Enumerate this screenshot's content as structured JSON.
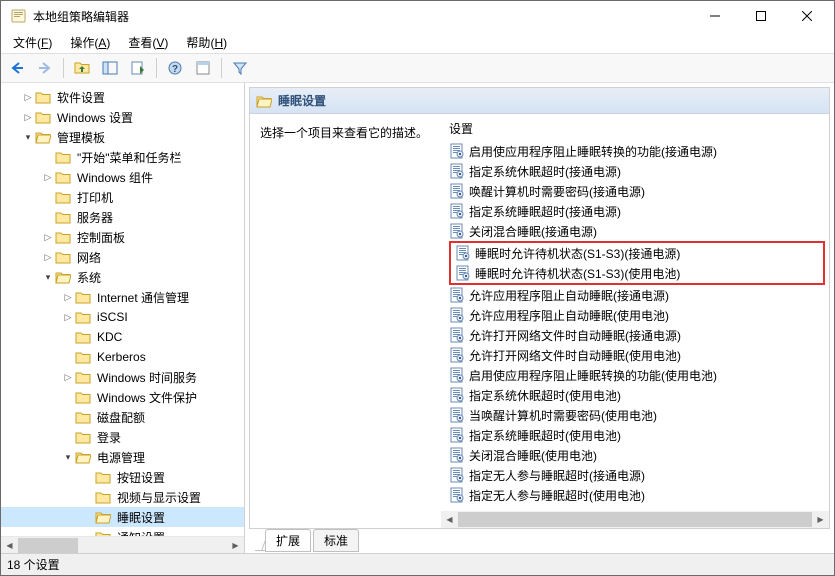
{
  "window": {
    "title": "本地组策略编辑器"
  },
  "menu": {
    "file": {
      "label": "文件",
      "accel": "F"
    },
    "action": {
      "label": "操作",
      "accel": "A"
    },
    "view": {
      "label": "查看",
      "accel": "V"
    },
    "help": {
      "label": "帮助",
      "accel": "H"
    }
  },
  "tree": {
    "软件设置": "软件设置",
    "Windows设置": "Windows 设置",
    "管理模板": "管理模板",
    "开始菜单和任务栏": "\"开始\"菜单和任务栏",
    "Windows组件": "Windows 组件",
    "打印机": "打印机",
    "服务器": "服务器",
    "控制面板": "控制面板",
    "网络": "网络",
    "系统": "系统",
    "Internet通信管理": "Internet 通信管理",
    "iSCSI": "iSCSI",
    "KDC": "KDC",
    "Kerberos": "Kerberos",
    "Windows时间服务": "Windows 时间服务",
    "Windows文件保护": "Windows 文件保护",
    "磁盘配额": "磁盘配额",
    "登录": "登录",
    "电源管理": "电源管理",
    "按钮设置": "按钮设置",
    "视频与显示设置": "视频与显示设置",
    "睡眠设置": "睡眠设置",
    "通知设置": "通知设置"
  },
  "rightHeader": "睡眠设置",
  "desc": "选择一个项目来查看它的描述。",
  "listHeader": "设置",
  "settings": [
    "启用使应用程序阻止睡眠转换的功能(接通电源)",
    "指定系统休眠超时(接通电源)",
    "唤醒计算机时需要密码(接通电源)",
    "指定系统睡眠超时(接通电源)",
    "关闭混合睡眠(接通电源)",
    "睡眠时允许待机状态(S1-S3)(接通电源)",
    "睡眠时允许待机状态(S1-S3)(使用电池)",
    "允许应用程序阻止自动睡眠(接通电源)",
    "允许应用程序阻止自动睡眠(使用电池)",
    "允许打开网络文件时自动睡眠(接通电源)",
    "允许打开网络文件时自动睡眠(使用电池)",
    "启用使应用程序阻止睡眠转换的功能(使用电池)",
    "指定系统休眠超时(使用电池)",
    "当唤醒计算机时需要密码(使用电池)",
    "指定系统睡眠超时(使用电池)",
    "关闭混合睡眠(使用电池)",
    "指定无人参与睡眠超时(接通电源)",
    "指定无人参与睡眠超时(使用电池)"
  ],
  "highlightedIndices": [
    5,
    6
  ],
  "tabs": {
    "extended": "扩展",
    "standard": "标准"
  },
  "status": "18 个设置"
}
